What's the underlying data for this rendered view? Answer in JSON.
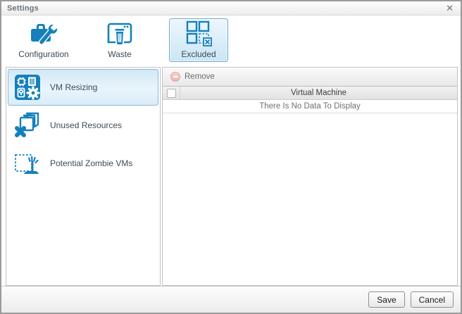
{
  "window": {
    "title": "Settings",
    "close_glyph": "✕"
  },
  "top_toolbar": {
    "items": [
      {
        "label": "Configuration",
        "icon": "toolbox-wrench-icon",
        "selected": false
      },
      {
        "label": "Waste",
        "icon": "window-trash-icon",
        "selected": false
      },
      {
        "label": "Excluded",
        "icon": "excluded-grid-icon",
        "selected": true
      }
    ]
  },
  "sidebar": {
    "items": [
      {
        "label": "VM Resizing",
        "icon": "vm-resizing-icon",
        "selected": true
      },
      {
        "label": "Unused Resources",
        "icon": "unused-resources-icon",
        "selected": false
      },
      {
        "label": "Potential Zombie VMs",
        "icon": "zombie-vm-icon",
        "selected": false
      }
    ]
  },
  "grid": {
    "toolbar": {
      "remove_label": "Remove"
    },
    "columns": [
      "Virtual Machine"
    ],
    "rows": [],
    "empty_message": "There Is No Data To Display"
  },
  "footer": {
    "save_label": "Save",
    "cancel_label": "Cancel"
  },
  "colors": {
    "accent_blue": "#1580bc",
    "selected_border": "#8cb8d8",
    "selected_bg": "#d9ecf8",
    "remove_icon_pink": "#eeb4ae",
    "dialog_border": "#9a9a9a"
  }
}
